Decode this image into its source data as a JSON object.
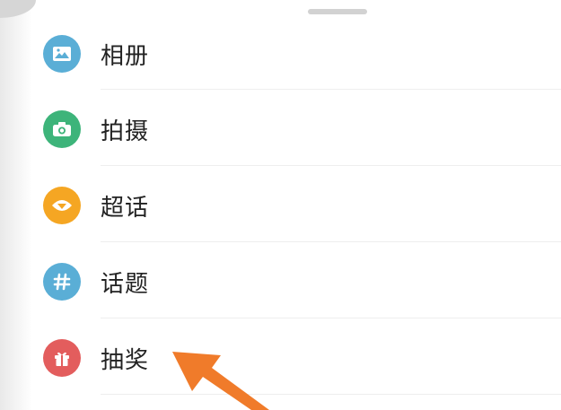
{
  "menu": {
    "items": [
      {
        "label": "相册",
        "icon": "photo-album-icon",
        "color": "#5aaed6"
      },
      {
        "label": "拍摄",
        "icon": "camera-icon",
        "color": "#3db47a"
      },
      {
        "label": "超话",
        "icon": "super-topic-icon",
        "color": "#f5a623"
      },
      {
        "label": "话题",
        "icon": "hashtag-icon",
        "color": "#5aaed6"
      },
      {
        "label": "抽奖",
        "icon": "gift-icon",
        "color": "#e35d5d"
      }
    ]
  },
  "annotation": {
    "arrow_color": "#f07b2a",
    "points_to": "抽奖"
  }
}
